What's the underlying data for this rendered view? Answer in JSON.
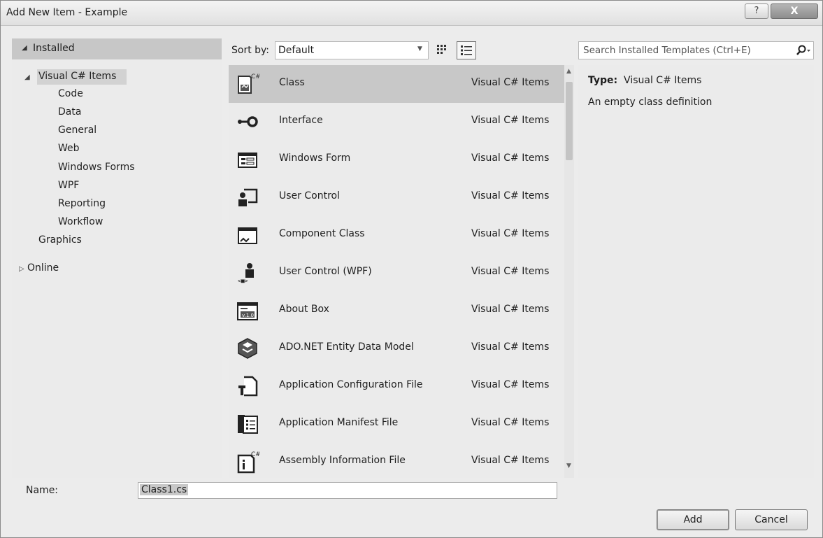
{
  "window": {
    "title": "Add New Item - Example",
    "help_glyph": "?",
    "close_glyph": "X"
  },
  "tree": {
    "installed_label": "Installed",
    "items": [
      {
        "label": "Visual C# Items",
        "selected": true
      },
      {
        "label": "Code"
      },
      {
        "label": "Data"
      },
      {
        "label": "General"
      },
      {
        "label": "Web"
      },
      {
        "label": "Windows Forms"
      },
      {
        "label": "WPF"
      },
      {
        "label": "Reporting"
      },
      {
        "label": "Workflow"
      },
      {
        "label": "Graphics"
      }
    ],
    "online_label": "Online"
  },
  "sort": {
    "label": "Sort by:",
    "value": "Default"
  },
  "templates": [
    {
      "name": "Class",
      "category": "Visual C# Items",
      "icon": "class-icon",
      "selected": true
    },
    {
      "name": "Interface",
      "category": "Visual C# Items",
      "icon": "interface-icon"
    },
    {
      "name": "Windows Form",
      "category": "Visual C# Items",
      "icon": "windows-form-icon"
    },
    {
      "name": "User Control",
      "category": "Visual C# Items",
      "icon": "user-control-icon"
    },
    {
      "name": "Component Class",
      "category": "Visual C# Items",
      "icon": "component-class-icon"
    },
    {
      "name": "User Control (WPF)",
      "category": "Visual C# Items",
      "icon": "user-control-wpf-icon"
    },
    {
      "name": "About Box",
      "category": "Visual C# Items",
      "icon": "about-box-icon"
    },
    {
      "name": "ADO.NET Entity Data Model",
      "category": "Visual C# Items",
      "icon": "entity-data-model-icon"
    },
    {
      "name": "Application Configuration File",
      "category": "Visual C# Items",
      "icon": "config-file-icon"
    },
    {
      "name": "Application Manifest File",
      "category": "Visual C# Items",
      "icon": "manifest-file-icon"
    },
    {
      "name": "Assembly Information File",
      "category": "Visual C# Items",
      "icon": "assembly-info-icon"
    }
  ],
  "search": {
    "placeholder": "Search Installed Templates (Ctrl+E)"
  },
  "details": {
    "type_label": "Type:",
    "type_value": "Visual C# Items",
    "description": "An empty class definition"
  },
  "name_field": {
    "label": "Name:",
    "value": "Class1.cs"
  },
  "buttons": {
    "add": "Add",
    "cancel": "Cancel"
  }
}
